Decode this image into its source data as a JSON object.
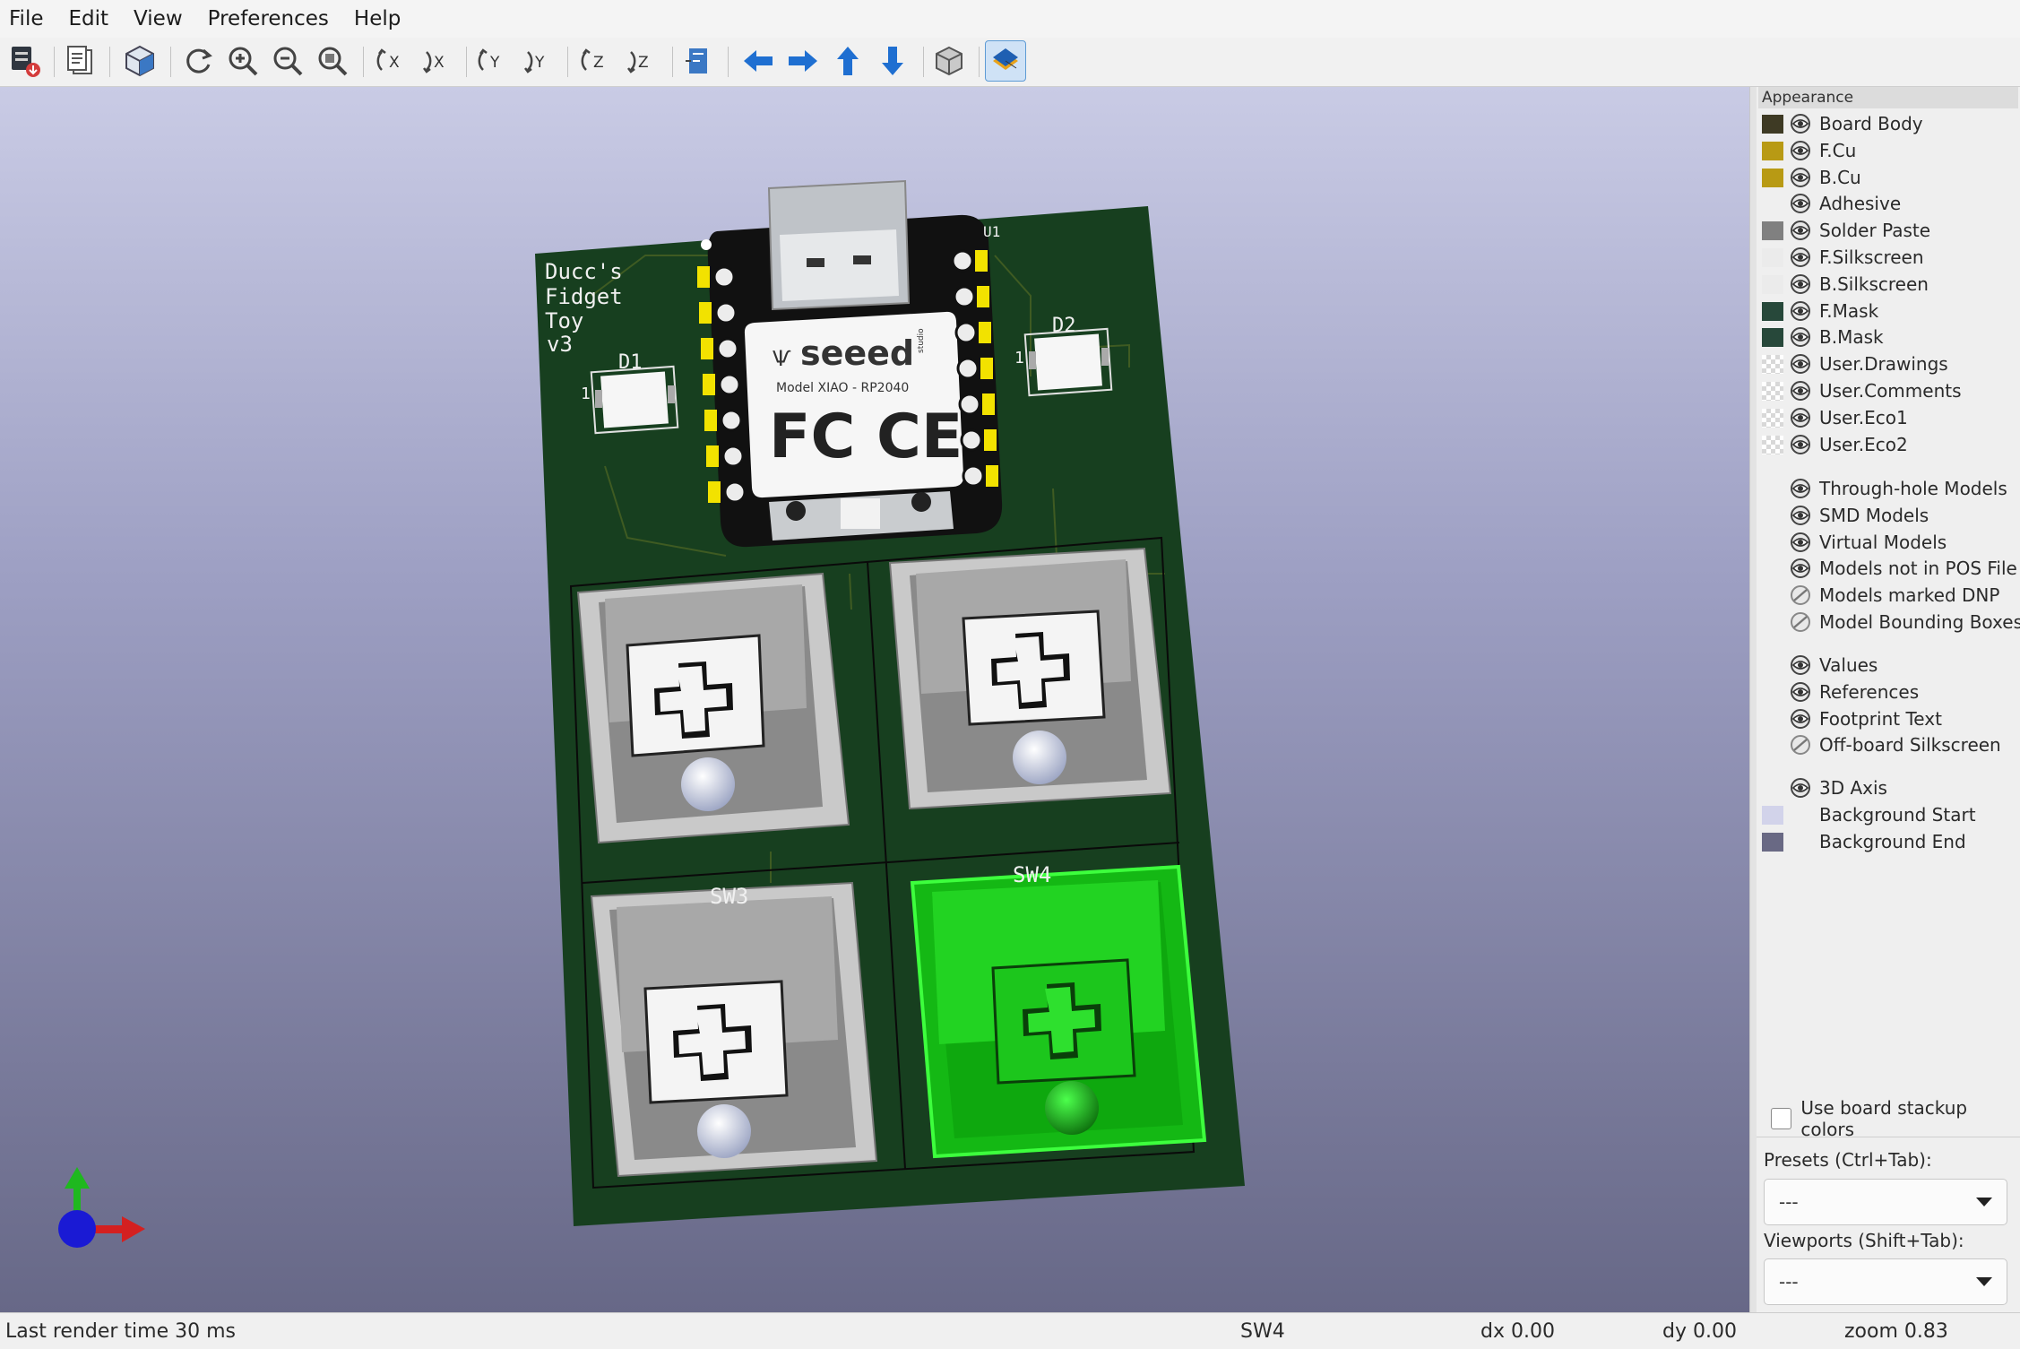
{
  "menu": [
    "File",
    "Edit",
    "View",
    "Preferences",
    "Help"
  ],
  "toolbar": {
    "buttons": [
      "render-raytracing",
      "copy-image",
      "board-view",
      "reload-board",
      "zoom-in",
      "zoom-out",
      "zoom-fit",
      "rotate-x-cw",
      "rotate-x-ccw",
      "rotate-y-cw",
      "rotate-y-ccw",
      "rotate-z-cw",
      "rotate-z-ccw",
      "flip-board",
      "move-left",
      "move-right",
      "move-up",
      "move-down",
      "orthographic-toggle",
      "layers-manager-toggle"
    ],
    "active": "layers-manager-toggle"
  },
  "board": {
    "title_lines": [
      "Ducc's",
      "Fidget",
      "Toy",
      "v3"
    ],
    "u1_ref": "U1",
    "d1_ref": "D1",
    "d2_ref": "D2",
    "pin1_left": "1",
    "pin1_right": "1",
    "sw3_ref": "SW3",
    "sw4_ref": "SW4",
    "module_brand": "seeed",
    "module_brand_sub": "studio",
    "module_model": "Model XIAO - RP2040",
    "module_cert": "FC CE",
    "selected": "SW4"
  },
  "appearance": {
    "title": "Appearance",
    "layers": [
      {
        "label": "Board Body",
        "color": "#3e3a24",
        "eye": true
      },
      {
        "label": "F.Cu",
        "color": "#b89a14",
        "eye": true
      },
      {
        "label": "B.Cu",
        "color": "#b89a14",
        "eye": true
      },
      {
        "label": "Adhesive",
        "color": "",
        "eye": true
      },
      {
        "label": "Solder Paste",
        "color": "#808080",
        "eye": true
      },
      {
        "label": "F.Silkscreen",
        "color": "#ebebeb",
        "eye": true
      },
      {
        "label": "B.Silkscreen",
        "color": "#ebebeb",
        "eye": true
      },
      {
        "label": "F.Mask",
        "color": "#27483a",
        "eye": true
      },
      {
        "label": "B.Mask",
        "color": "#27483a",
        "eye": true
      },
      {
        "label": "User.Drawings",
        "color": "checker",
        "eye": true
      },
      {
        "label": "User.Comments",
        "color": "checker",
        "eye": true
      },
      {
        "label": "User.Eco1",
        "color": "checker",
        "eye": true
      },
      {
        "label": "User.Eco2",
        "color": "checker",
        "eye": true
      }
    ],
    "models": [
      {
        "label": "Through-hole Models",
        "eye": true
      },
      {
        "label": "SMD Models",
        "eye": true
      },
      {
        "label": "Virtual Models",
        "eye": true
      },
      {
        "label": "Models not in POS File",
        "eye": true
      },
      {
        "label": "Models marked DNP",
        "eye": false
      },
      {
        "label": "Model Bounding Boxes",
        "eye": false
      }
    ],
    "texts": [
      {
        "label": "Values",
        "eye": true
      },
      {
        "label": "References",
        "eye": true
      },
      {
        "label": "Footprint Text",
        "eye": true
      },
      {
        "label": "Off-board Silkscreen",
        "eye": false
      }
    ],
    "misc": [
      {
        "label": "3D Axis",
        "color": "",
        "eye": true
      },
      {
        "label": "Background Start",
        "color": "#d2d3ea",
        "eye": null
      },
      {
        "label": "Background End",
        "color": "#696984",
        "eye": null
      }
    ],
    "stackup_checkbox": "Use board stackup colors",
    "stackup_checked": false,
    "presets_label": "Presets (Ctrl+Tab):",
    "presets_value": "---",
    "viewports_label": "Viewports (Shift+Tab):",
    "viewports_value": "---"
  },
  "status": {
    "render_time": "Last render time 30 ms",
    "selection": "SW4",
    "dx": "dx 0.00",
    "dy": "dy 0.00",
    "zoom": "zoom 0.83"
  }
}
